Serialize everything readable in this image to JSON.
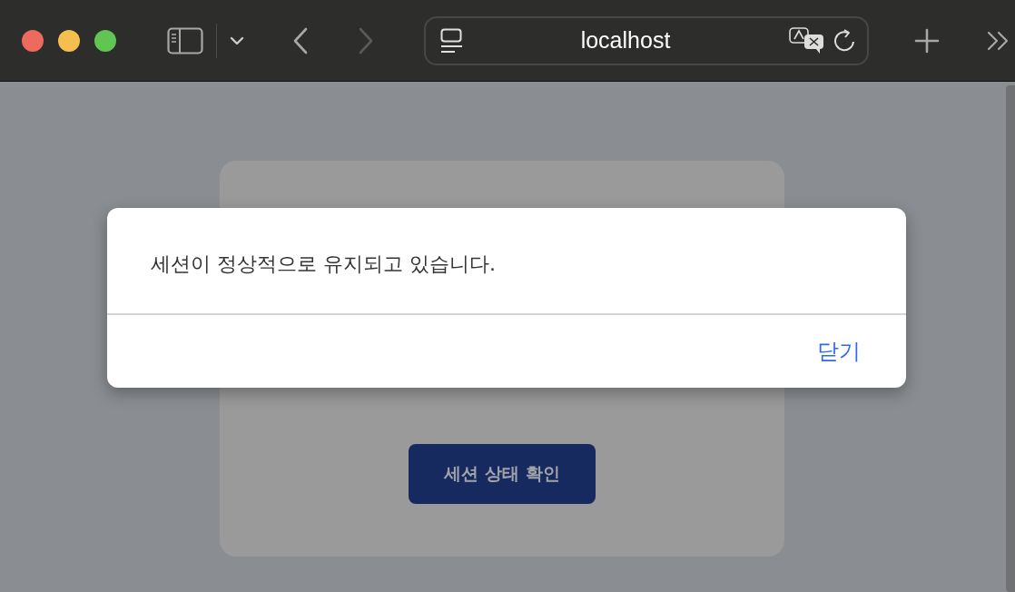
{
  "browser": {
    "url": "localhost",
    "nav": [
      {
        "kind": "back",
        "disabled": false
      },
      {
        "kind": "forward",
        "disabled": true
      }
    ]
  },
  "page": {
    "button": "세션 상태 확인"
  },
  "dialog": {
    "message": "세션이 정상적으로 유지되고 있습니다.",
    "close": "닫기"
  }
}
